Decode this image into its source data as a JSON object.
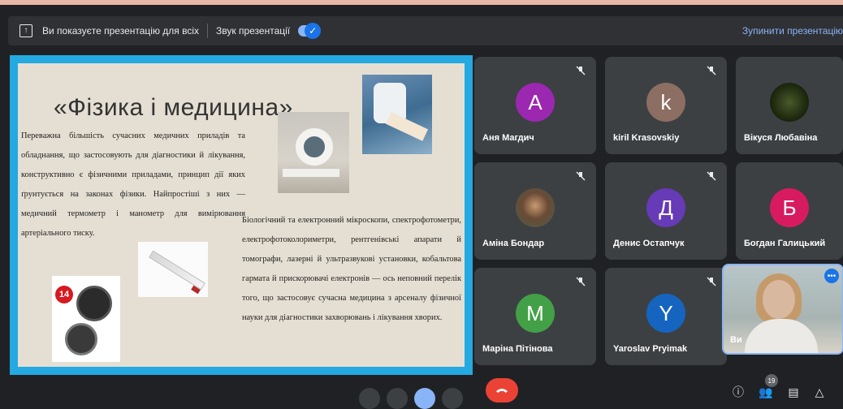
{
  "banner": {
    "present_text": "Ви показуєте презентацію для всіх",
    "sound_label": "Звук презентації",
    "stop_label": "Зупинити презентацію"
  },
  "slide": {
    "title": "«Фізика і медицина»",
    "paragraph1": "Переважна більшість сучасних медичних приладів та обладнання, що застосовують для діагностики й лікування, конструктивно є фізичними приладами, принцип дії яких ґрунтується на законах фізики. Найпростіші з них — медичний термометр і манометр для вимірювання артеріального тиску.",
    "paragraph2": "Біологічний та електронний мікроскопи, спектрофотометри, електрофотоколориметри, рентгенівські апарати й томографи, лазерні й ультразвукові установки, кобальтова гармата й прискорювачі електронів — ось неповний перелік того, що застосовує сучасна медицина з арсеналу фізичної науки для діагностики захворювань і лікування хворих.",
    "badge_text": "14"
  },
  "participants": [
    {
      "name": "Аня Магдич",
      "initial": "A",
      "color": "#9c27b0"
    },
    {
      "name": "kiril Krasovskiy",
      "initial": "k",
      "color": "#8d6e63"
    },
    {
      "name": "Вікуся Любавіна",
      "initial": "",
      "color": ""
    },
    {
      "name": "Аміна Бондар",
      "initial": "",
      "color": ""
    },
    {
      "name": "Денис Остапчук",
      "initial": "Д",
      "color": "#673ab7"
    },
    {
      "name": "Богдан Галицький",
      "initial": "Б",
      "color": "#d81b60"
    },
    {
      "name": "Маріна Пітінова",
      "initial": "M",
      "color": "#43a047"
    },
    {
      "name": "Yaroslav Pryimak",
      "initial": "Y",
      "color": "#1565c0"
    }
  ],
  "self_tile": {
    "name": "Ви"
  },
  "controls": {
    "participant_count": "19"
  }
}
